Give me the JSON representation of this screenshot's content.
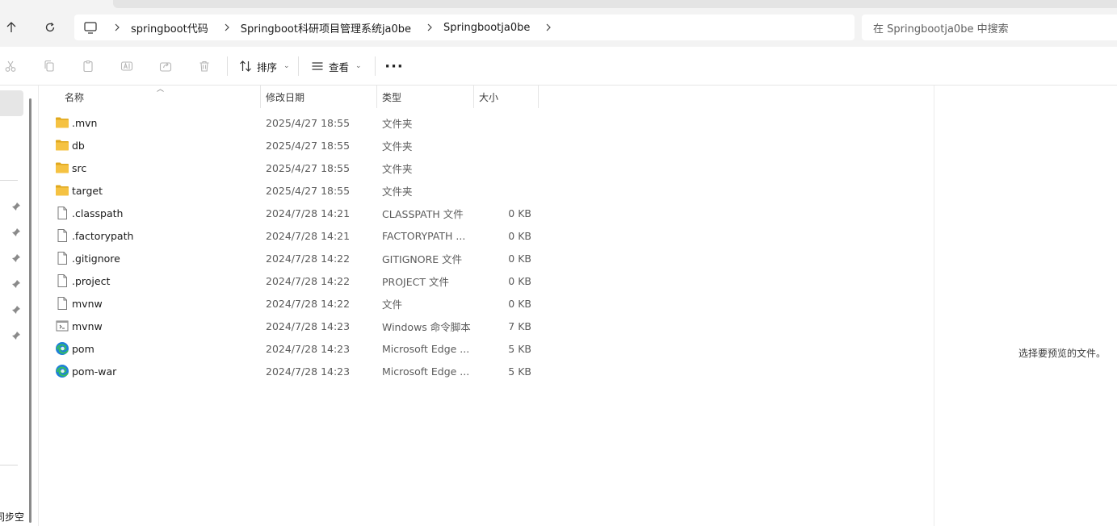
{
  "address": {
    "crumbs": [
      "springboot代码",
      "Springboot科研项目管理系统ja0be",
      "Springbootja0be"
    ],
    "search_placeholder": "在 Springbootja0be 中搜索"
  },
  "toolbar": {
    "sort_label": "排序",
    "view_label": "查看",
    "more_label": "···"
  },
  "columns": {
    "name": "名称",
    "modified": "修改日期",
    "type": "类型",
    "size": "大小"
  },
  "files": [
    {
      "name": ".mvn",
      "date": "2025/4/27 18:55",
      "type": "文件夹",
      "size": "",
      "icon": "folder-icon"
    },
    {
      "name": "db",
      "date": "2025/4/27 18:55",
      "type": "文件夹",
      "size": "",
      "icon": "folder-icon"
    },
    {
      "name": "src",
      "date": "2025/4/27 18:55",
      "type": "文件夹",
      "size": "",
      "icon": "folder-icon"
    },
    {
      "name": "target",
      "date": "2025/4/27 18:55",
      "type": "文件夹",
      "size": "",
      "icon": "folder-icon"
    },
    {
      "name": ".classpath",
      "date": "2024/7/28 14:21",
      "type": "CLASSPATH 文件",
      "size": "0 KB",
      "icon": "file-icon"
    },
    {
      "name": ".factorypath",
      "date": "2024/7/28 14:21",
      "type": "FACTORYPATH ...",
      "size": "0 KB",
      "icon": "file-icon"
    },
    {
      "name": ".gitignore",
      "date": "2024/7/28 14:22",
      "type": "GITIGNORE 文件",
      "size": "0 KB",
      "icon": "file-icon"
    },
    {
      "name": ".project",
      "date": "2024/7/28 14:22",
      "type": "PROJECT 文件",
      "size": "0 KB",
      "icon": "file-icon"
    },
    {
      "name": "mvnw",
      "date": "2024/7/28 14:22",
      "type": "文件",
      "size": "0 KB",
      "icon": "file-icon"
    },
    {
      "name": "mvnw",
      "date": "2024/7/28 14:23",
      "type": "Windows 命令脚本",
      "size": "7 KB",
      "icon": "script-icon"
    },
    {
      "name": "pom",
      "date": "2024/7/28 14:23",
      "type": "Microsoft Edge ...",
      "size": "5 KB",
      "icon": "edge-icon"
    },
    {
      "name": "pom-war",
      "date": "2024/7/28 14:23",
      "type": "Microsoft Edge ...",
      "size": "5 KB",
      "icon": "edge-icon"
    }
  ],
  "left_pane": {
    "bottom_text": "同步空"
  },
  "preview": {
    "message": "选择要预览的文件。"
  },
  "colors": {
    "folder": "#f5c242",
    "folder_dark": "#e0a81e",
    "edge_blue": "#1f7fd8",
    "edge_green": "#35c15b"
  }
}
